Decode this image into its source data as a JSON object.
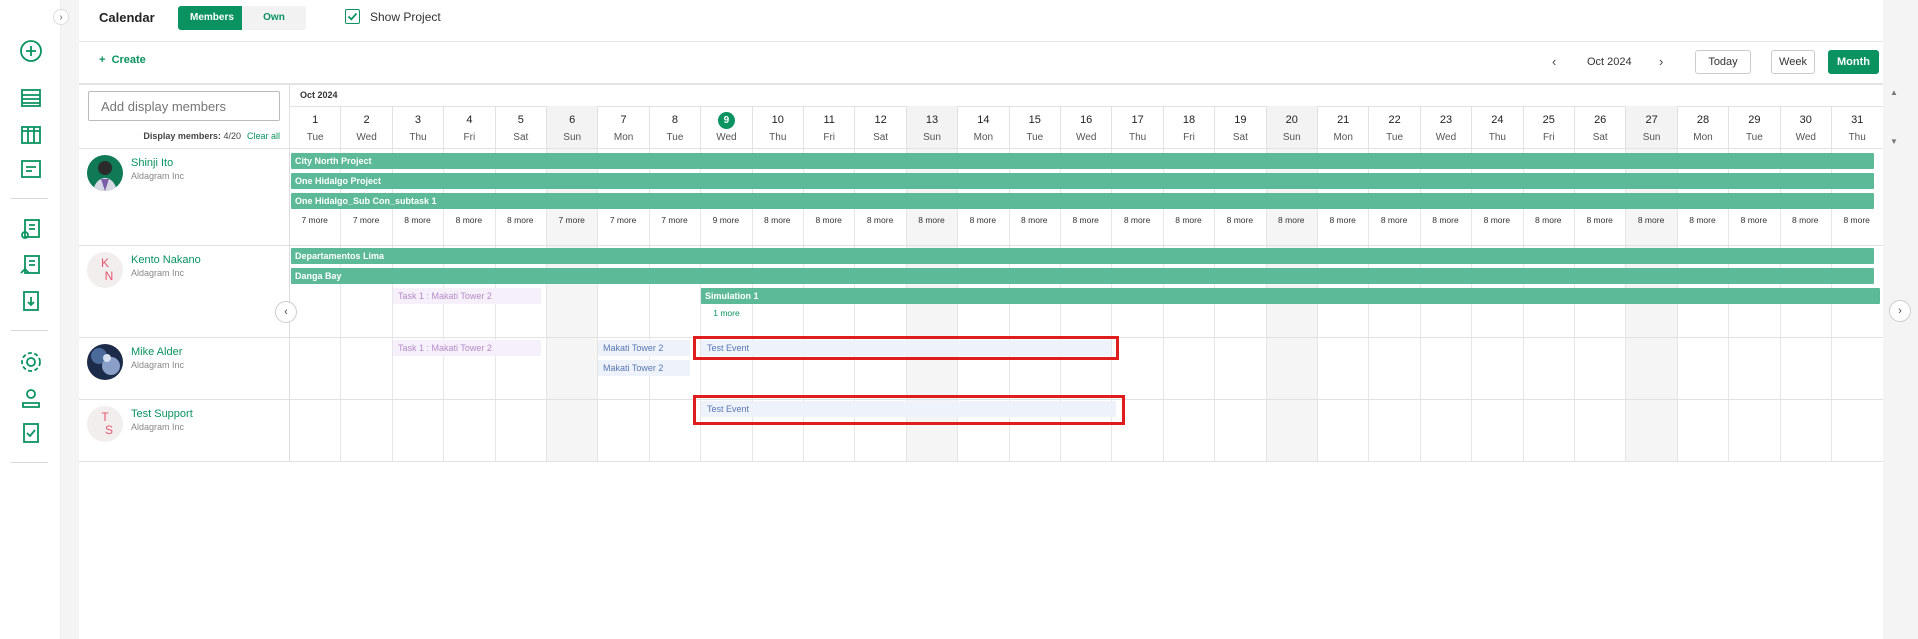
{
  "header": {
    "title": "Calendar",
    "toggle_members": "Members",
    "toggle_own": "Own",
    "show_project": "Show Project"
  },
  "toolbar": {
    "create": "Create",
    "period": "Oct 2024",
    "today": "Today",
    "week": "Week",
    "month": "Month"
  },
  "search": {
    "placeholder": "Add display members"
  },
  "display": {
    "label": "Display members:",
    "count": "4/20",
    "clear": "Clear all"
  },
  "calendar": {
    "month_label": "Oct 2024",
    "today_index": 8,
    "days": [
      {
        "n": "1",
        "w": "Tue"
      },
      {
        "n": "2",
        "w": "Wed"
      },
      {
        "n": "3",
        "w": "Thu"
      },
      {
        "n": "4",
        "w": "Fri"
      },
      {
        "n": "5",
        "w": "Sat"
      },
      {
        "n": "6",
        "w": "Sun"
      },
      {
        "n": "7",
        "w": "Mon"
      },
      {
        "n": "8",
        "w": "Tue"
      },
      {
        "n": "9",
        "w": "Wed"
      },
      {
        "n": "10",
        "w": "Thu"
      },
      {
        "n": "11",
        "w": "Fri"
      },
      {
        "n": "12",
        "w": "Sat"
      },
      {
        "n": "13",
        "w": "Sun"
      },
      {
        "n": "14",
        "w": "Mon"
      },
      {
        "n": "15",
        "w": "Tue"
      },
      {
        "n": "16",
        "w": "Wed"
      },
      {
        "n": "17",
        "w": "Thu"
      },
      {
        "n": "18",
        "w": "Fri"
      },
      {
        "n": "19",
        "w": "Sat"
      },
      {
        "n": "20",
        "w": "Sun"
      },
      {
        "n": "21",
        "w": "Mon"
      },
      {
        "n": "22",
        "w": "Tue"
      },
      {
        "n": "23",
        "w": "Wed"
      },
      {
        "n": "24",
        "w": "Thu"
      },
      {
        "n": "25",
        "w": "Fri"
      },
      {
        "n": "26",
        "w": "Sat"
      },
      {
        "n": "27",
        "w": "Sun"
      },
      {
        "n": "28",
        "w": "Mon"
      },
      {
        "n": "29",
        "w": "Tue"
      },
      {
        "n": "30",
        "w": "Wed"
      },
      {
        "n": "31",
        "w": "Thu"
      }
    ]
  },
  "members": [
    {
      "name": "Shinji Ito",
      "org": "Aldagram Inc",
      "avatar": "photo",
      "projects": [
        "City North Project",
        "One Hidalgo Project",
        "One Hidalgo_Sub Con_subtask 1"
      ],
      "more": [
        "7 more",
        "7 more",
        "8 more",
        "8 more",
        "8 more",
        "7 more",
        "7 more",
        "7 more",
        "9 more",
        "8 more",
        "8 more",
        "8 more",
        "8 more",
        "8 more",
        "8 more",
        "8 more",
        "8 more",
        "8 more",
        "8 more",
        "8 more",
        "8 more",
        "8 more",
        "8 more",
        "8 more",
        "8 more",
        "8 more",
        "8 more",
        "8 more",
        "8 more",
        "8 more",
        "8 more"
      ]
    },
    {
      "name": "Kento Nakano",
      "org": "Aldagram Inc",
      "initials": [
        "K",
        "N"
      ],
      "projects": [
        "Departamentos Lima",
        "Danga Bay"
      ],
      "task": "Task 1 : Makati Tower 2",
      "simulation": "Simulation 1",
      "more": "1 more"
    },
    {
      "name": "Mike Alder",
      "org": "Aldagram Inc",
      "avatar": "photo",
      "task": "Task 1 : Makati Tower 2",
      "tower_a": "Makati Tower 2",
      "tower_b": "Makati Tower 2",
      "event": "Test Event"
    },
    {
      "name": "Test Support",
      "org": "Aldagram Inc",
      "initials": [
        "T",
        "S"
      ],
      "event": "Test Event"
    }
  ],
  "colors": {
    "accent": "#0a9360",
    "bar": "#5cba98",
    "highlight": "#e01d1d"
  }
}
